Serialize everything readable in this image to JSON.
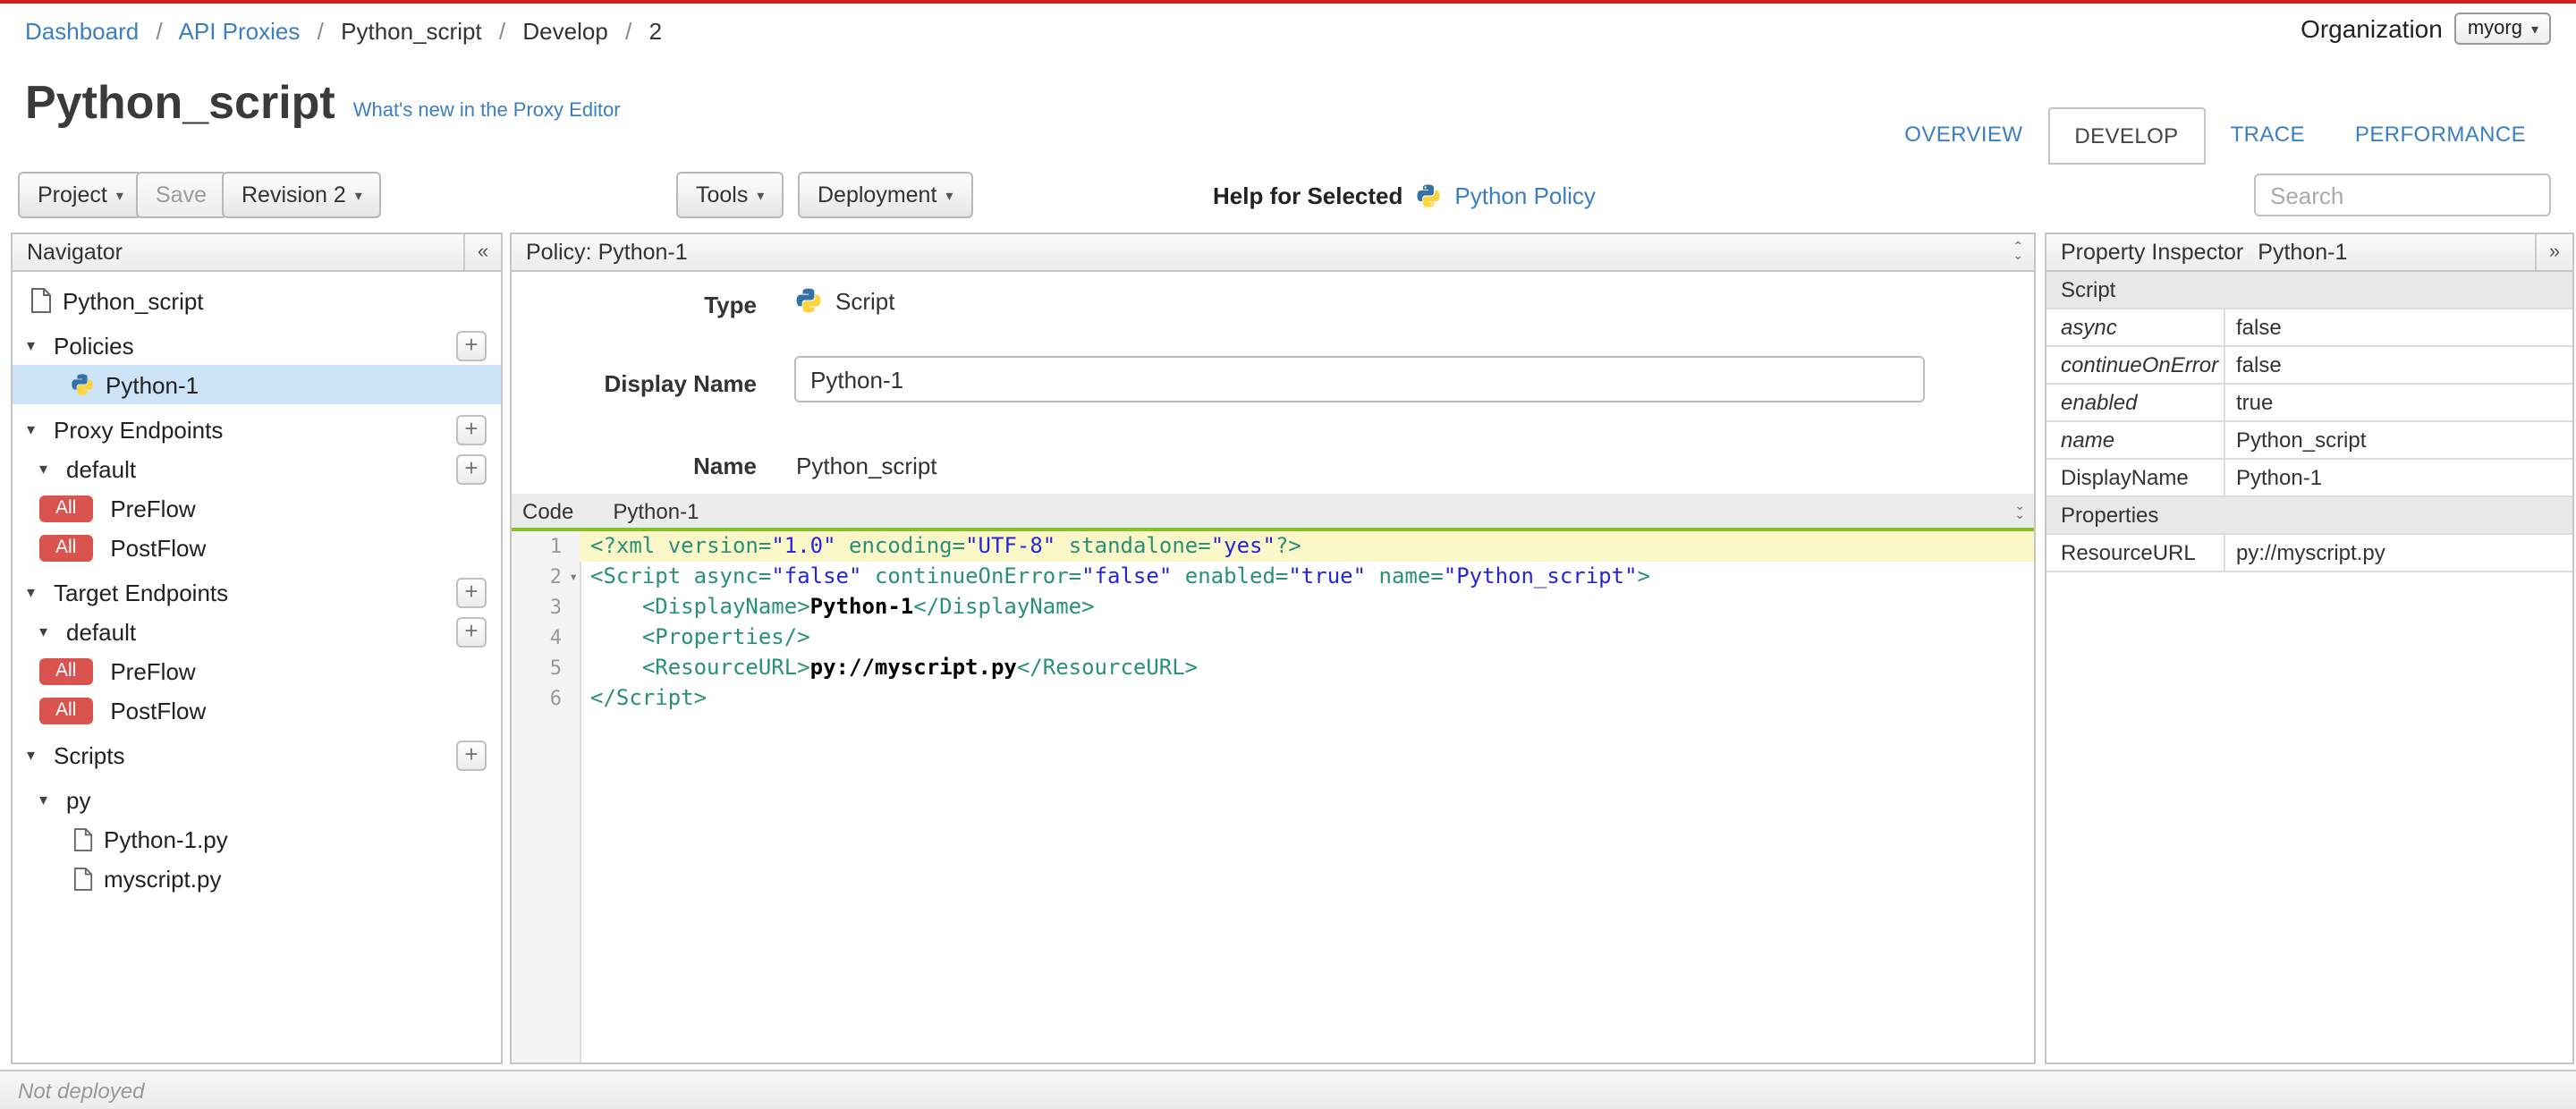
{
  "icons": {
    "caret_down": "▾",
    "plus": "+",
    "collapse_left": "«",
    "expand_right": "»",
    "chevron_up": "⌃",
    "chevron_down": "⌄",
    "separator": "/"
  },
  "breadcrumb": {
    "dashboard": "Dashboard",
    "api_proxies": "API Proxies",
    "proxy": "Python_script",
    "develop": "Develop",
    "revision": "2"
  },
  "org": {
    "label": "Organization",
    "value": "myorg"
  },
  "header": {
    "title": "Python_script",
    "whats_new": "What's new in the Proxy Editor"
  },
  "tabs": {
    "overview": "OVERVIEW",
    "develop": "DEVELOP",
    "trace": "TRACE",
    "performance": "PERFORMANCE"
  },
  "toolbar": {
    "project": "Project",
    "save": "Save",
    "revision": "Revision 2",
    "tools": "Tools",
    "deployment": "Deployment",
    "help_label": "Help for Selected",
    "help_link": "Python Policy",
    "search_placeholder": "Search"
  },
  "navigator": {
    "title": "Navigator",
    "root": "Python_script",
    "policies": "Policies",
    "policy_item": "Python-1",
    "proxy_endpoints": "Proxy Endpoints",
    "target_endpoints": "Target Endpoints",
    "endpoint_default": "default",
    "flow_all": "All",
    "preflow": "PreFlow",
    "postflow": "PostFlow",
    "scripts": "Scripts",
    "script_group": "py",
    "script_file_1": "Python-1.py",
    "script_file_2": "myscript.py"
  },
  "policy": {
    "panel_title": "Policy: Python-1",
    "type_label": "Type",
    "type_value": "Script",
    "display_name_label": "Display Name",
    "display_name_value": "Python-1",
    "name_label": "Name",
    "name_value": "Python_script"
  },
  "code_panel": {
    "tab_label": "Code",
    "file_label": "Python-1",
    "lines": [
      {
        "n": "1",
        "active": true,
        "fold": false,
        "tokens": [
          {
            "c": "tag",
            "s": "<?xml "
          },
          {
            "c": "attr",
            "s": "version="
          },
          {
            "c": "str",
            "s": "\"1.0\""
          },
          {
            "c": "txt",
            "s": " "
          },
          {
            "c": "attr",
            "s": "encoding="
          },
          {
            "c": "str",
            "s": "\"UTF-8\""
          },
          {
            "c": "txt",
            "s": " "
          },
          {
            "c": "attr",
            "s": "standalone="
          },
          {
            "c": "str",
            "s": "\"yes\""
          },
          {
            "c": "tag",
            "s": "?>"
          }
        ]
      },
      {
        "n": "2",
        "active": false,
        "fold": true,
        "tokens": [
          {
            "c": "tag",
            "s": "<Script "
          },
          {
            "c": "attr",
            "s": "async="
          },
          {
            "c": "str",
            "s": "\"false\""
          },
          {
            "c": "txt",
            "s": " "
          },
          {
            "c": "attr",
            "s": "continueOnError="
          },
          {
            "c": "str",
            "s": "\"false\""
          },
          {
            "c": "txt",
            "s": " "
          },
          {
            "c": "attr",
            "s": "enabled="
          },
          {
            "c": "str",
            "s": "\"true\""
          },
          {
            "c": "txt",
            "s": " "
          },
          {
            "c": "attr",
            "s": "name="
          },
          {
            "c": "str",
            "s": "\"Python_script\""
          },
          {
            "c": "tag",
            "s": ">"
          }
        ]
      },
      {
        "n": "3",
        "active": false,
        "fold": false,
        "tokens": [
          {
            "c": "txt",
            "s": "    "
          },
          {
            "c": "tag",
            "s": "<DisplayName>"
          },
          {
            "c": "txt",
            "s": "Python-1"
          },
          {
            "c": "tag",
            "s": "</DisplayName>"
          }
        ]
      },
      {
        "n": "4",
        "active": false,
        "fold": false,
        "tokens": [
          {
            "c": "txt",
            "s": "    "
          },
          {
            "c": "tag",
            "s": "<Properties/>"
          }
        ]
      },
      {
        "n": "5",
        "active": false,
        "fold": false,
        "tokens": [
          {
            "c": "txt",
            "s": "    "
          },
          {
            "c": "tag",
            "s": "<ResourceURL>"
          },
          {
            "c": "txt",
            "s": "py://myscript.py"
          },
          {
            "c": "tag",
            "s": "</ResourceURL>"
          }
        ]
      },
      {
        "n": "6",
        "active": false,
        "fold": false,
        "tokens": [
          {
            "c": "tag",
            "s": "</Script>"
          }
        ]
      }
    ]
  },
  "inspector": {
    "title": "Property Inspector",
    "subtitle": "Python-1",
    "section": "Script",
    "properties_section": "Properties",
    "rows": [
      {
        "name": "async",
        "value": "false"
      },
      {
        "name": "continueOnError",
        "value": "false"
      },
      {
        "name": "enabled",
        "value": "true"
      },
      {
        "name": "name",
        "value": "Python_script"
      },
      {
        "name": "DisplayName",
        "value": "Python-1"
      },
      {
        "name": "ResourceURL",
        "value": "py://myscript.py"
      }
    ]
  },
  "status": {
    "text": "Not deployed"
  }
}
